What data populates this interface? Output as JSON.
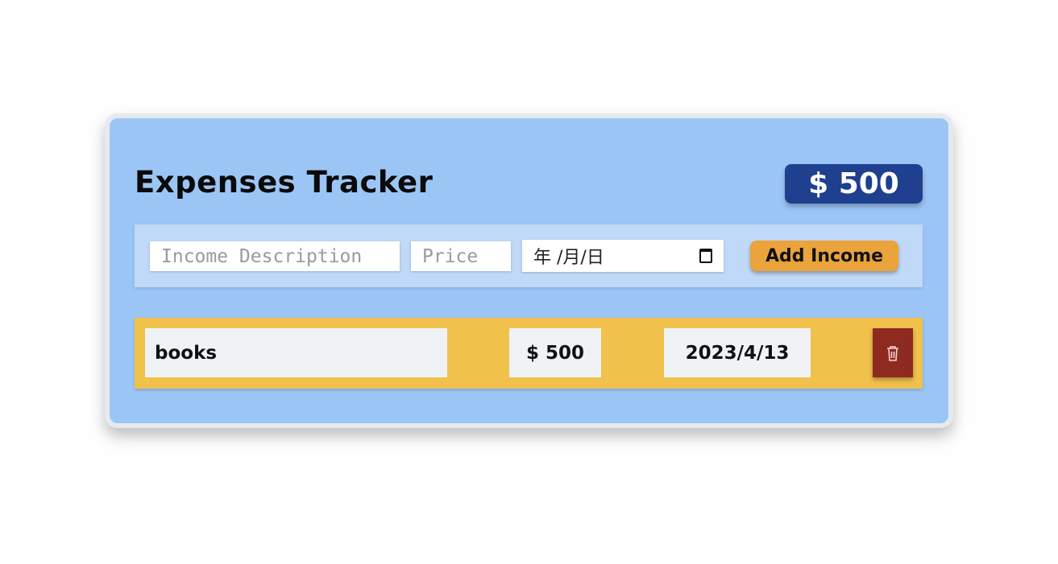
{
  "header": {
    "title": "Expenses Tracker",
    "balance": "$ 500"
  },
  "form": {
    "description_placeholder": "Income Description",
    "price_placeholder": "Price",
    "date_placeholder": "年 /月/日",
    "add_label": "Add Income"
  },
  "entries": [
    {
      "description": "books",
      "price": "$ 500",
      "date": "2023/4/13",
      "delete_icon": "trash-icon"
    }
  ],
  "colors": {
    "card": "#9bc5f5",
    "badge": "#1f3f8f",
    "button": "#eba33b",
    "row": "#f0c14b",
    "delete": "#8f2a20"
  }
}
